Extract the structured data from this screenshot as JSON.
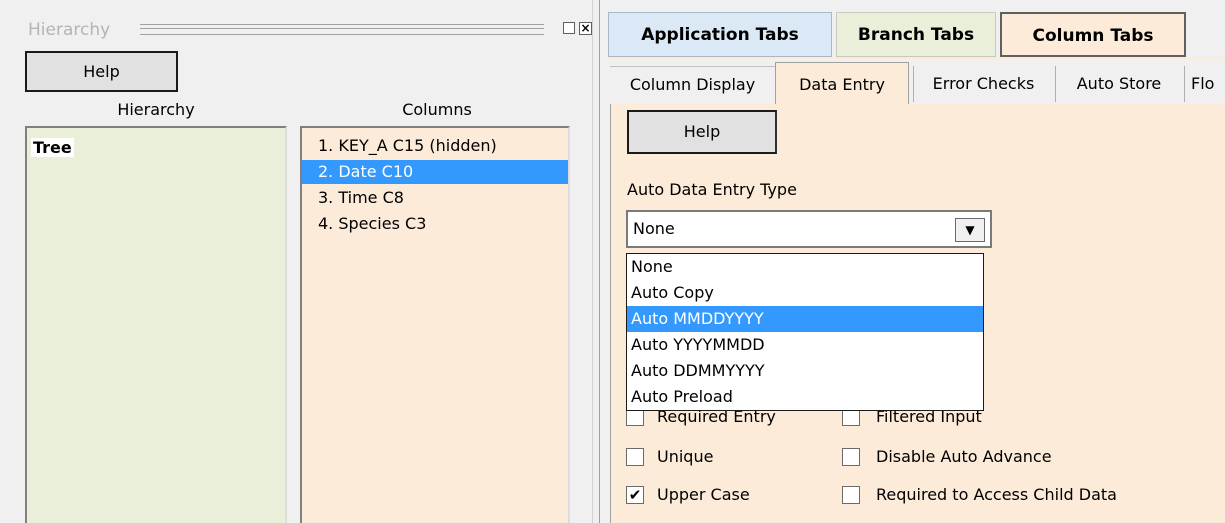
{
  "left": {
    "title": "Hierarchy",
    "help_label": "Help",
    "hierarchy_header": "Hierarchy",
    "columns_header": "Columns",
    "tree_root": "Tree",
    "columns": [
      "1. KEY_A C15 (hidden)",
      "2. Date C10",
      "3. Time C8",
      "4. Species C3"
    ],
    "selected_column_index": 1
  },
  "right": {
    "main_tabs": [
      "Application Tabs",
      "Branch Tabs",
      "Column Tabs"
    ],
    "active_main_tab": "Column Tabs",
    "sub_tabs": [
      "Column Display",
      "Data Entry",
      "Error Checks",
      "Auto Store",
      "Flo"
    ],
    "active_sub_tab": "Data Entry",
    "help_label": "Help",
    "auto_data_entry_label": "Auto Data Entry Type",
    "combo_value": "None",
    "dropdown_options": [
      "None",
      "Auto Copy",
      "Auto MMDDYYYY",
      "Auto YYYYMMDD",
      "Auto DDMMYYYY",
      "Auto Preload"
    ],
    "dropdown_highlight_index": 2,
    "checkboxes": {
      "required_entry": {
        "label": "Required Entry",
        "checked": false
      },
      "filtered_input": {
        "label": "Filtered Input",
        "checked": false
      },
      "unique": {
        "label": "Unique",
        "checked": false
      },
      "disable_auto_advance": {
        "label": "Disable Auto Advance",
        "checked": false
      },
      "upper_case": {
        "label": "Upper Case",
        "checked": true
      },
      "required_child": {
        "label": "Required to Access Child Data",
        "checked": false
      }
    }
  },
  "colors": {
    "selection": "#3399ff",
    "tree_bg": "#e9efd9",
    "columns_bg": "#fcebd9",
    "application_tab_bg": "#dbe8f5"
  },
  "icons": {
    "restore": "restore-icon",
    "close": "close-icon",
    "dropdown": "chevron-down-icon",
    "check": "checkmark-icon"
  }
}
